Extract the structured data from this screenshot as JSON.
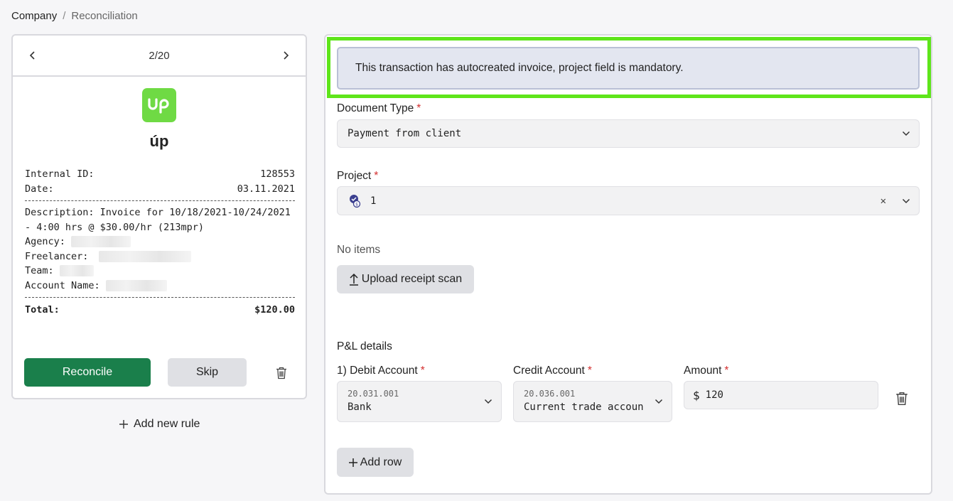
{
  "breadcrumb": {
    "root": "Company",
    "separator": "/",
    "current": "Reconciliation"
  },
  "pager": {
    "count": "2/20",
    "prev_icon": "chevron-left-icon",
    "next_icon": "chevron-right-icon"
  },
  "vendor": {
    "name": "úp",
    "logo_text": "up",
    "logo_color": "#6fda44"
  },
  "receipt": {
    "internal_id_label": "Internal ID:",
    "internal_id": "128553",
    "date_label": "Date:",
    "date": "03.11.2021",
    "description_line1": "Description: Invoice for 10/18/2021-10/24/2021",
    "description_line2": "- 4:00 hrs @ $30.00/hr (213mpr)",
    "agency_label": "Agency:",
    "freelancer_label": "Freelancer:",
    "team_label": "Team:",
    "account_name_label": "Account Name:",
    "total_label": "Total:",
    "total_value": "$120.00"
  },
  "actions": {
    "reconcile": "Reconcile",
    "skip": "Skip",
    "add_rule": "Add new rule"
  },
  "alert": {
    "text": "This transaction has autocreated invoice, project field is mandatory."
  },
  "form": {
    "document_type_label": "Document Type",
    "document_type_value": "Payment from client",
    "project_label": "Project",
    "project_value": "1",
    "no_items": "No items",
    "upload_label": "Upload receipt scan",
    "pl_details": "P&L details",
    "debit_label": "1) Debit Account",
    "debit_code": "20.031.001",
    "debit_name": "Bank",
    "credit_label": "Credit Account",
    "credit_code": "20.036.001",
    "credit_name": "Current trade accoun",
    "amount_label": "Amount",
    "amount_currency": "$",
    "amount_value": "120",
    "add_row": "Add row",
    "required_mark": "*"
  },
  "colors": {
    "primary": "#1a7f4b",
    "highlight": "#5ee51a",
    "alert_bg": "#e3e6f0",
    "required": "#d32f2f"
  }
}
